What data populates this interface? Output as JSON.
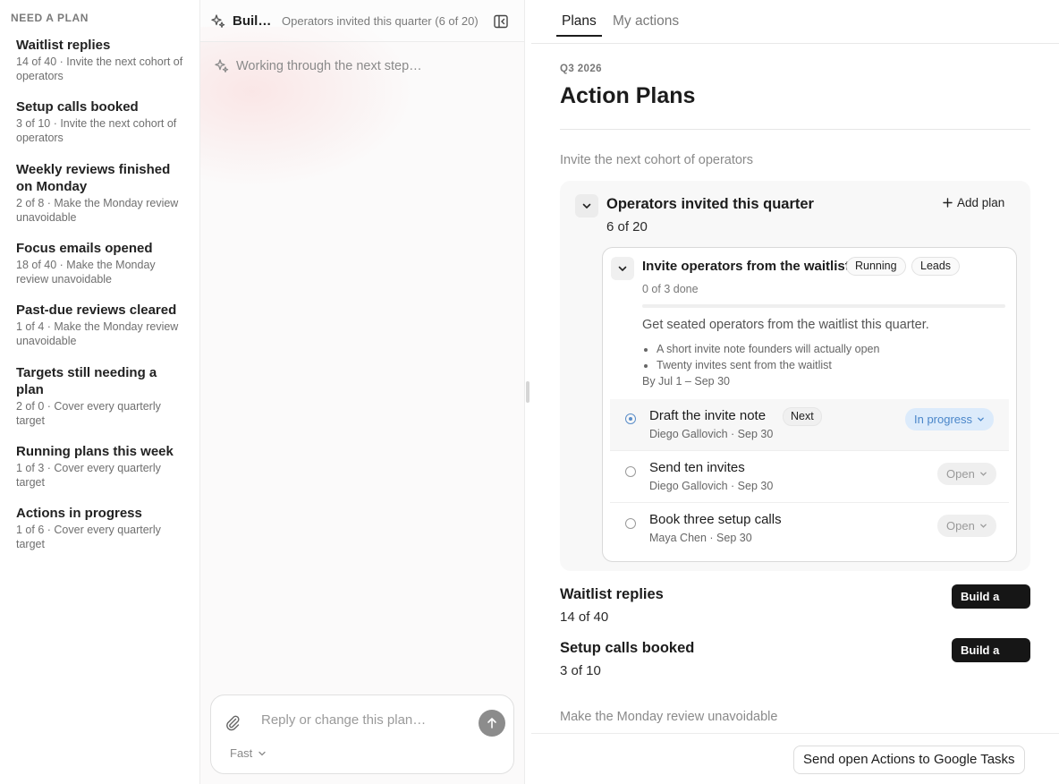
{
  "sidebar": {
    "heading": "NEED A PLAN",
    "items": [
      {
        "title": "Waitlist replies",
        "subtitle": "14 of 40 · Invite the next cohort of operators"
      },
      {
        "title": "Setup calls booked",
        "subtitle": "3 of 10 · Invite the next cohort of operators"
      },
      {
        "title": "Weekly reviews finished on Monday",
        "subtitle": "2 of 8 · Make the Monday review unavoidable"
      },
      {
        "title": "Focus emails opened",
        "subtitle": "18 of 40 · Make the Monday review unavoidable"
      },
      {
        "title": "Past-due reviews cleared",
        "subtitle": "1 of 4 · Make the Monday review unavoidable"
      },
      {
        "title": "Targets still needing a plan",
        "subtitle": "2 of 0 · Cover every quarterly target"
      },
      {
        "title": "Running plans this week",
        "subtitle": "1 of 3 · Cover every quarterly target"
      },
      {
        "title": "Actions in progress",
        "subtitle": "1 of 6 · Cover every quarterly target"
      }
    ]
  },
  "chat": {
    "title": "Building",
    "context": "Operators invited this quarter (6 of 20)",
    "status": "Working through the next step…",
    "composer": {
      "placeholder": "Reply or change this plan…",
      "model": "Fast"
    }
  },
  "main": {
    "tabs": [
      {
        "label": "Plans",
        "active": true
      },
      {
        "label": "My actions",
        "active": false
      }
    ],
    "quarter": "Q3 2026",
    "title": "Action Plans",
    "objectives": [
      {
        "label": "Invite the next cohort of operators"
      },
      {
        "label": "Make the Monday review unavoidable"
      }
    ],
    "target": {
      "title": "Operators invited this quarter",
      "count": "6 of 20",
      "add_plan": "Add plan",
      "plan": {
        "title": "Invite operators from the waitlist",
        "status": "Running",
        "owner_tag": "Leads",
        "progress_text": "0 of 3 done",
        "progress_fraction": 0,
        "goal": "Get seated operators from the waitlist this quarter.",
        "bullets": [
          "A short invite note founders will actually open",
          "Twenty invites sent from the waitlist"
        ],
        "dates": "By Jul 1 – Sep 30",
        "tasks": [
          {
            "name": "Draft the invite note",
            "tag": "Next",
            "meta": "Diego Gallovich · Sep 30",
            "status": "In progress"
          },
          {
            "name": "Send ten invites",
            "meta": "Diego Gallovich · Sep 30",
            "status": "Open"
          },
          {
            "name": "Book three setup calls",
            "meta": "Maya Chen · Sep 30",
            "status": "Open"
          }
        ]
      }
    },
    "other_targets": [
      {
        "title": "Waitlist replies",
        "count": "14 of 40",
        "action": "Build a plan"
      },
      {
        "title": "Setup calls booked",
        "count": "3 of 10",
        "action": "Build a plan"
      }
    ],
    "export_label": "Send open Actions to Google Tasks"
  },
  "colors": {
    "accent_dark": "#161616",
    "in_progress_bg": "#dcebfb",
    "in_progress_text": "#4a86c9"
  }
}
